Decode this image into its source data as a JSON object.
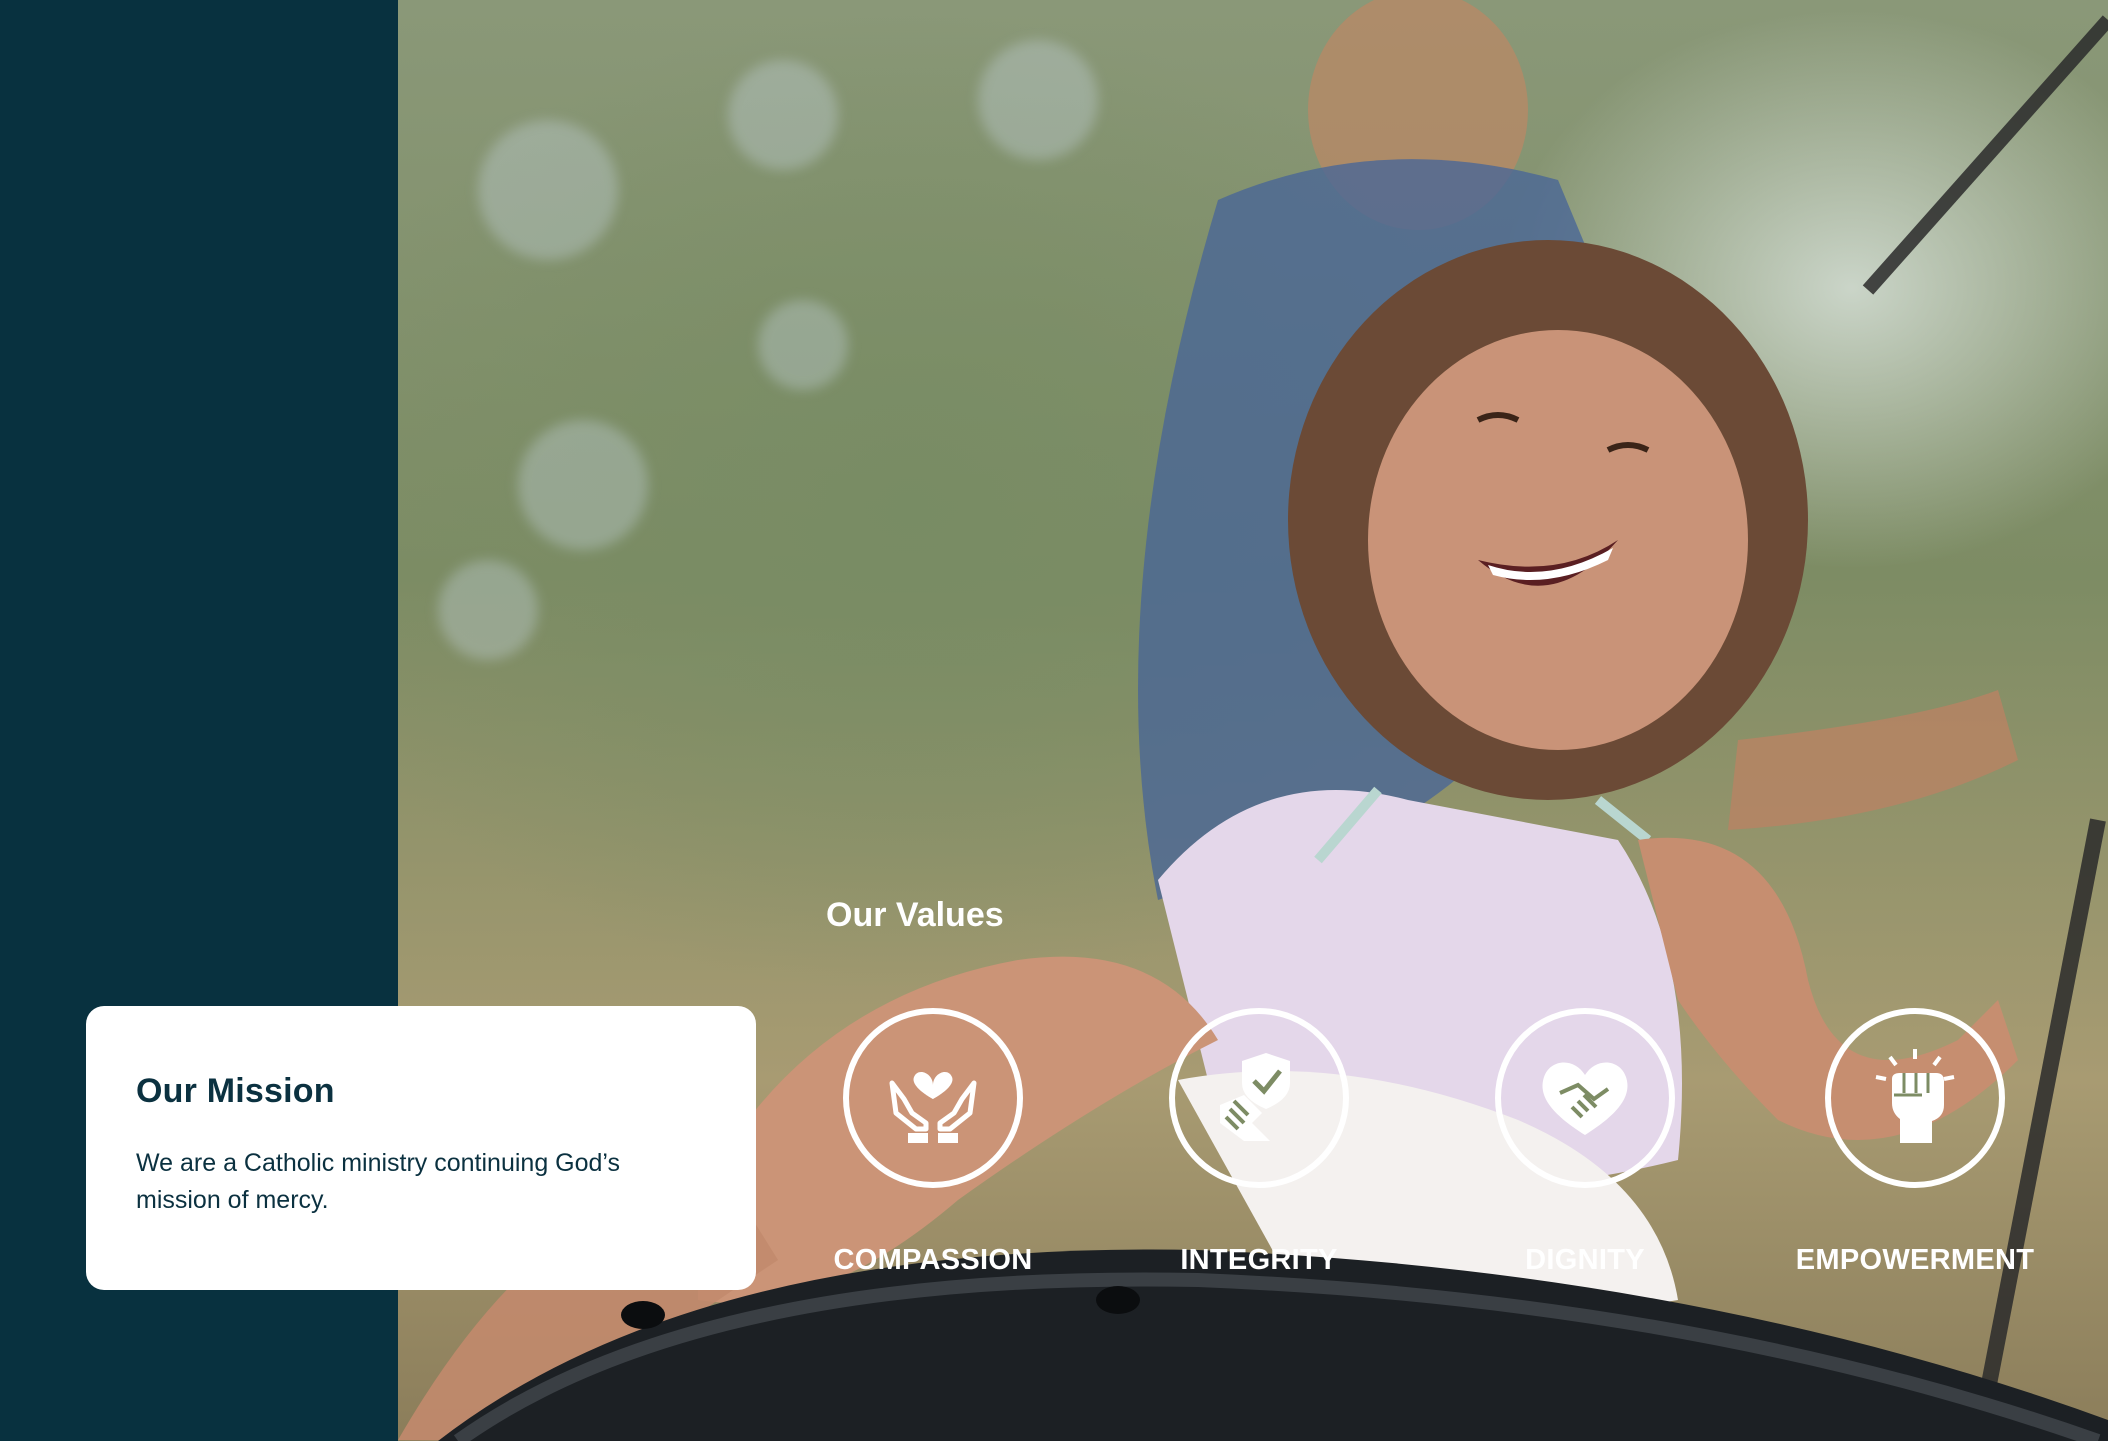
{
  "mission": {
    "title": "Our Mission",
    "text": "We are a Catholic ministry continuing God’s mission of mercy."
  },
  "values": {
    "title": "Our Values",
    "items": [
      {
        "label": "COMPASSION",
        "icon": "heart-in-hands-icon"
      },
      {
        "label": "INTEGRITY",
        "icon": "handshake-shield-icon"
      },
      {
        "label": "DIGNITY",
        "icon": "heart-handshake-icon"
      },
      {
        "label": "EMPOWERMENT",
        "icon": "raised-fist-icon"
      }
    ]
  },
  "colors": {
    "panel": "#08313f",
    "card": "#ffffff",
    "text_dark": "#0b3140",
    "text_light": "#ffffff"
  }
}
